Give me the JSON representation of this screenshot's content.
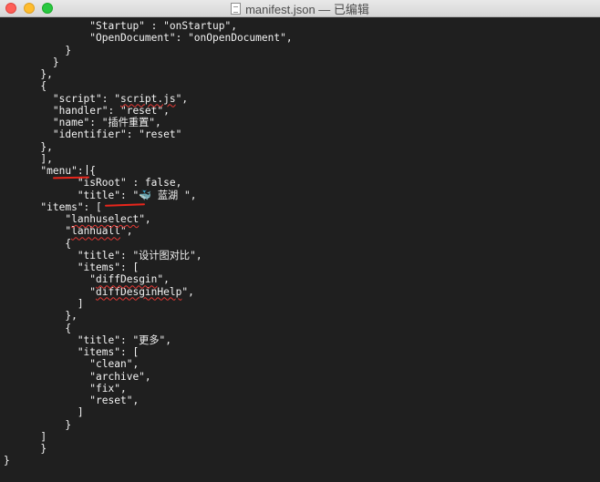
{
  "window": {
    "title": "manifest.json — 已编辑"
  },
  "editor": {
    "lines": [
      "              \"Startup\" : \"onStartup\",",
      "              \"OpenDocument\": \"onOpenDocument\",",
      "          }",
      "        }",
      "      },",
      "      {",
      "        \"script\": \"script.js\",",
      "        \"handler\": \"reset\",",
      "        \"name\": \"插件重置\",",
      "        \"identifier\": \"reset\"",
      "      },",
      "      ],",
      "      \"menu\": {",
      "            \"isRoot\" : false,",
      "            \"title\": \"🐳 蓝湖 \",",
      "      \"items\": [",
      "          \"lanhuselect\",",
      "          \"lanhuall\",",
      "          {",
      "            \"title\": \"设计图对比\",",
      "            \"items\": [",
      "              \"diffDesgin\",",
      "              \"diffDesginHelp\",",
      "            ]",
      "          },",
      "          {",
      "            \"title\": \"更多\",",
      "            \"items\": [",
      "              \"clean\",",
      "              \"archive\",",
      "              \"fix\",",
      "              \"reset\",",
      "            ]",
      "          }",
      "      ]",
      "      }",
      "}"
    ]
  },
  "colors": {
    "background": "#1f1f1f",
    "text": "#f2f2f2",
    "annotation": "#e8261c",
    "spell_underline": "#e53935"
  }
}
